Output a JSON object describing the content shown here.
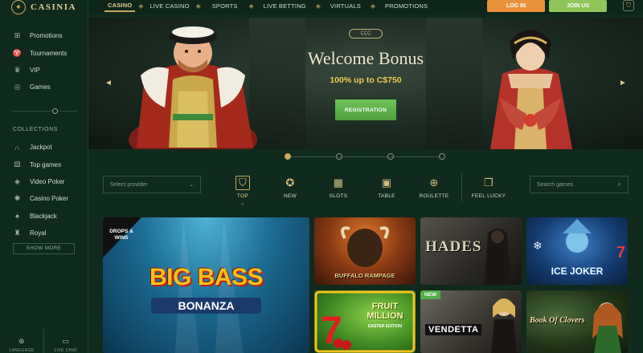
{
  "brand": {
    "name": "CASINIA"
  },
  "sidebar": {
    "items": [
      {
        "label": "Promotions",
        "icon": "gift-icon"
      },
      {
        "label": "Tournaments",
        "icon": "trophy-icon"
      },
      {
        "label": "VIP",
        "icon": "crown-icon"
      },
      {
        "label": "Games",
        "icon": "globe-icon"
      }
    ],
    "collections_title": "COLLECTIONS",
    "collections": [
      {
        "label": "Jackpot",
        "icon": "horseshoe-icon"
      },
      {
        "label": "Top games",
        "icon": "dice-icon"
      },
      {
        "label": "Video Poker",
        "icon": "chip-icon"
      },
      {
        "label": "Casino Poker",
        "icon": "poker-chip-icon"
      },
      {
        "label": "Blackjack",
        "icon": "cards-icon"
      },
      {
        "label": "Royal",
        "icon": "castle-icon"
      }
    ],
    "show_more": "SHOW MORE",
    "bottom": {
      "language": "LANGUAGE",
      "live_chat": "LIVE CHAT"
    }
  },
  "topnav": {
    "items": [
      "CASINO",
      "LIVE CASINO",
      "SPORTS",
      "LIVE BETTING",
      "VIRTUALS",
      "PROMOTIONS"
    ],
    "active": "CASINO",
    "login": "LOG IN",
    "join": "JOIN US"
  },
  "hero": {
    "badge": "ÇÇÇ",
    "title": "Welcome Bonus",
    "subtitle": "100% up to C$750",
    "cta": "REGISTRATION",
    "slides_total": 4,
    "slide_active": 1
  },
  "filters": {
    "provider_placeholder": "Select provider",
    "categories": [
      {
        "label": "TOP",
        "icon": "shield-icon",
        "active": true
      },
      {
        "label": "NEW",
        "icon": "star-circle-icon",
        "active": false
      },
      {
        "label": "SLOTS",
        "icon": "slot-machine-icon",
        "active": false
      },
      {
        "label": "TABLE",
        "icon": "cards-icon",
        "active": false
      },
      {
        "label": "ROULETTE",
        "icon": "roulette-icon",
        "active": false
      },
      {
        "label": "FEEL LUCKY",
        "icon": "clover-cards-icon",
        "active": false
      }
    ],
    "search_placeholder": "Search games"
  },
  "games": {
    "featured": {
      "title": "BIG BASS",
      "subtitle": "BONANZA",
      "badge": "DROPS & WINS"
    },
    "tiles": [
      {
        "name": "BUFFALO RAMPAGE"
      },
      {
        "name": "HADES"
      },
      {
        "name": "ICE JOKER"
      },
      {
        "name": "FRUIT MILLION",
        "subtitle": "EASTER EDITION"
      },
      {
        "name": "VENDETTA",
        "badge": "NEW"
      },
      {
        "name": "Book Of Clovers"
      }
    ]
  },
  "colors": {
    "accent": "#c9a860",
    "login": "#e9923a",
    "join": "#8fc65a",
    "bg": "#102a1d"
  }
}
